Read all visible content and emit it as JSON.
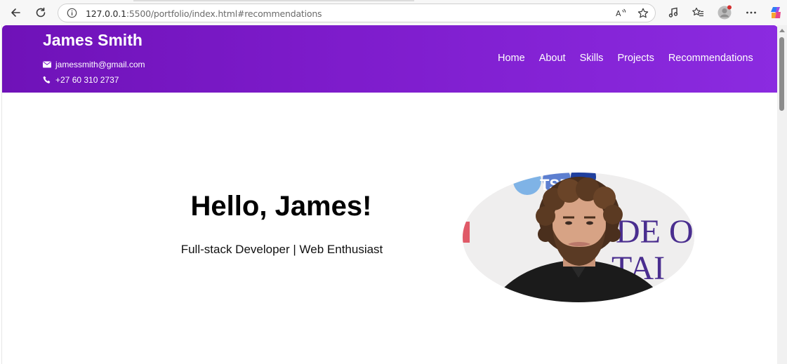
{
  "browser": {
    "url_host": "127.0.0.1",
    "url_path": ":5500/portfolio/index.html#recommendations",
    "read_aloud_label": "A"
  },
  "site": {
    "name": "James Smith",
    "email": "jamessmith@gmail.com",
    "phone": "+27 60 310 2737",
    "nav": [
      {
        "label": "Home"
      },
      {
        "label": "About"
      },
      {
        "label": "Skills"
      },
      {
        "label": "Projects"
      },
      {
        "label": "Recommendations"
      }
    ]
  },
  "hero": {
    "title": "Hello, James!",
    "subtitle": "Full-stack Developer | Web Enthusiast"
  },
  "backdrop_text": {
    "sponsor": "TSB",
    "letters_top": "DE O",
    "letters_bottom": "TAI"
  },
  "colors": {
    "header_start": "#6f12b8",
    "header_end": "#8b2be0",
    "profile_alert": "#d32f2f",
    "copilot_blue": "#2f7cf6"
  }
}
